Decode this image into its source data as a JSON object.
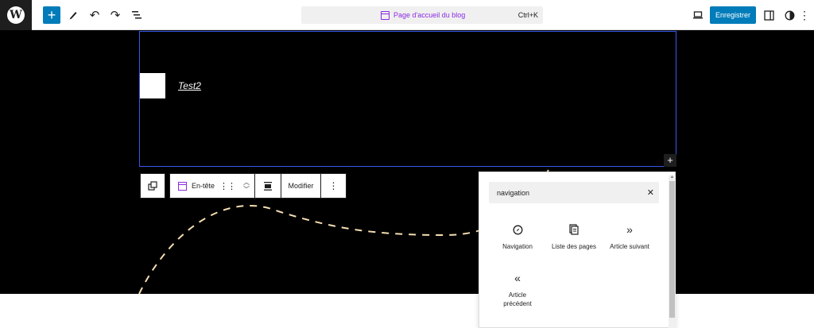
{
  "toolbar": {
    "document_title": "Page d'accueil du blog",
    "shortcut": "Ctrl+K",
    "save_label": "Enregistrer"
  },
  "canvas": {
    "site_title": "Test2"
  },
  "block_toolbar": {
    "block_name": "En-tête",
    "edit_label": "Modifier"
  },
  "inserter": {
    "search_value": "navigation",
    "results": [
      {
        "label": "Navigation",
        "icon": "compass-icon"
      },
      {
        "label": "Liste des pages",
        "icon": "page-list-icon"
      },
      {
        "label": "Article suivant",
        "icon": "chevron-double-right-icon"
      },
      {
        "label": "Article précédent",
        "icon": "chevron-double-left-icon"
      }
    ]
  },
  "colors": {
    "accent": "#007cba",
    "template": "#8a2be2",
    "selection": "#3858e9",
    "curve": "#f5deb3"
  }
}
